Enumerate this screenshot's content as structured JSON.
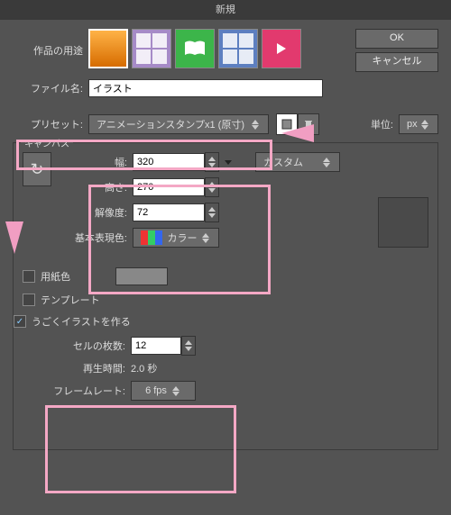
{
  "title": "新規",
  "buttons": {
    "ok": "OK",
    "cancel": "キャンセル"
  },
  "labels": {
    "purpose": "作品の用途",
    "filename": "ファイル名:",
    "preset": "プリセット:",
    "unit": "単位:",
    "canvas": "キャンバス",
    "width": "幅:",
    "height": "高さ:",
    "resolution": "解像度:",
    "colormode": "基本表現色:",
    "custom": "カスタム",
    "papercolor": "用紙色",
    "template": "テンプレート",
    "animate": "うごくイラストを作る",
    "cells": "セルの枚数:",
    "playtime": "再生時間:",
    "framerate": "フレームレート:"
  },
  "values": {
    "filename": "イラスト",
    "preset": "アニメーションスタンプx1 (原寸)",
    "unit": "px",
    "width": "320",
    "height": "270",
    "resolution": "72",
    "colormode": "カラー",
    "cells": "12",
    "playtime": "2.0 秒",
    "framerate": "6 fps",
    "animate_checked": "✓"
  }
}
